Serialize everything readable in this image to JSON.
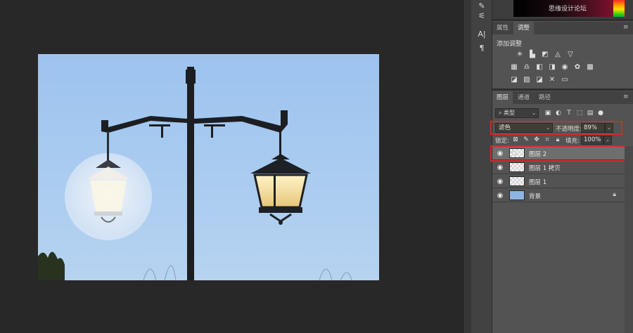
{
  "watermark": "思缘设计论坛",
  "properties_tabs": [
    {
      "label": "属性",
      "active": false
    },
    {
      "label": "调整",
      "active": true
    }
  ],
  "adjustments": {
    "title": "添加调整",
    "row1": [
      "brightness-contrast-icon",
      "levels-icon",
      "curves-icon",
      "exposure-icon"
    ],
    "row2": [
      "vibrance-icon",
      "hue-saturation-icon",
      "color-balance-icon",
      "black-white-icon",
      "photo-filter-icon",
      "channel-mixer-icon",
      "color-lookup-icon"
    ],
    "row3": [
      "invert-icon",
      "posterize-icon",
      "threshold-icon",
      "selective-color-icon",
      "gradient-map-icon"
    ]
  },
  "layers_tabs": [
    {
      "label": "图层",
      "active": true
    },
    {
      "label": "通道",
      "active": false
    },
    {
      "label": "路径",
      "active": false
    }
  ],
  "filter": {
    "kind_label": "类型"
  },
  "blend": {
    "mode": "滤色",
    "opacity_label": "不透明度:",
    "opacity_value": "89%"
  },
  "lock": {
    "label": "锁定:",
    "fill_label": "填充:",
    "fill_value": "100%"
  },
  "layers": [
    {
      "name": "图层 2",
      "selected": true
    },
    {
      "name": "图层 1 拷贝",
      "selected": false
    },
    {
      "name": "图层 1",
      "selected": false
    },
    {
      "name": "背景",
      "selected": false,
      "locked": true
    }
  ],
  "colors": {
    "highlight_box": "#d42a2a",
    "sky_top": "#9cc2ee",
    "sky_bottom": "#b4d2f0"
  }
}
